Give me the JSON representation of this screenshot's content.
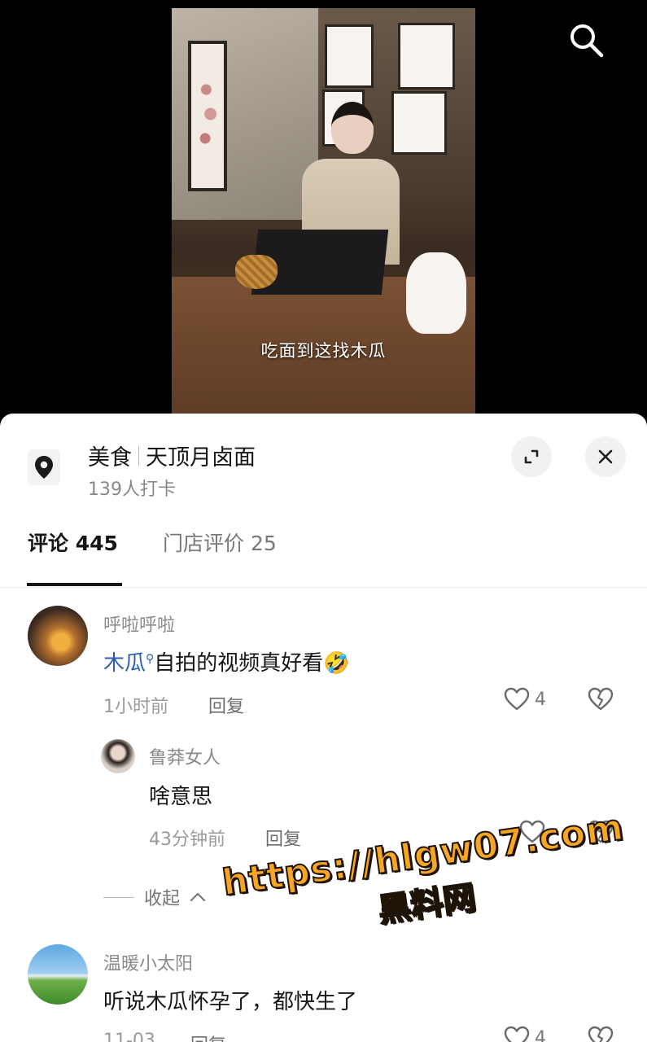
{
  "video": {
    "caption": "吃面到这找木瓜"
  },
  "poi": {
    "category": "美食",
    "name": "天顶月卤面",
    "checkins": "139人打卡"
  },
  "tabs": {
    "comments": "评论 445",
    "reviews": "门店评价 25"
  },
  "comments": [
    {
      "user": "呼啦呼啦",
      "mention": "木瓜",
      "text": "自拍的视频真好看🤣",
      "time": "1小时前",
      "reply": "回复",
      "likes": "4"
    },
    {
      "user": "鲁莽女人",
      "text": "啥意思",
      "time": "43分钟前",
      "reply": "回复",
      "likes": ""
    },
    {
      "user": "温暖小太阳",
      "text": "听说木瓜怀孕了，都快生了",
      "time": "11-03",
      "reply": "回复",
      "likes": "4"
    }
  ],
  "collapse_label": "收起",
  "watermark": {
    "url": "https://hlgw07.com",
    "name": "黑料网"
  },
  "icons": [
    "search-icon",
    "location-pin-icon",
    "expand-icon",
    "close-icon",
    "heart-icon",
    "broken-heart-icon",
    "chevron-up-icon"
  ]
}
